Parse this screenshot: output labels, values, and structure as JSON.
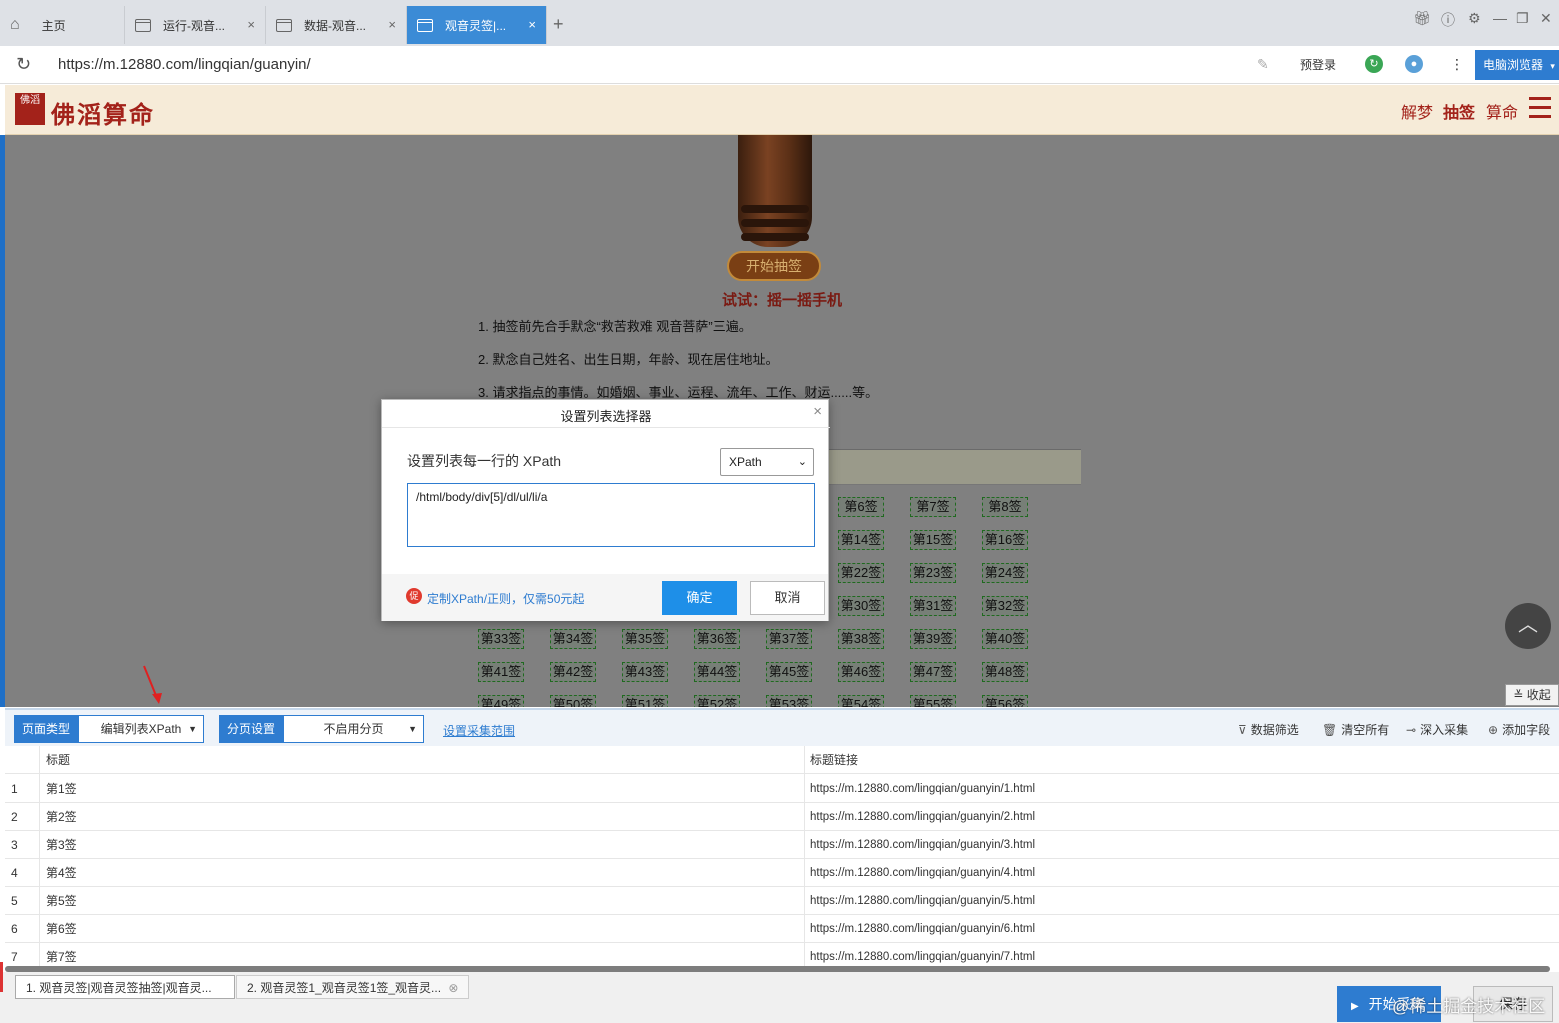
{
  "browser": {
    "tabs": [
      {
        "label": "主页"
      },
      {
        "label": "运行-观音..."
      },
      {
        "label": "数据-观音..."
      },
      {
        "label": "观音灵签|..."
      }
    ],
    "new_tab": "+",
    "url": "https://m.12880.com/lingqian/guanyin/",
    "prelogin": "预登录",
    "pc_browser": "电脑浏览器",
    "more": "⋮"
  },
  "site": {
    "seal": "佛滔",
    "logo": "佛滔算命",
    "nav": [
      "解梦",
      "抽签",
      "算命"
    ],
    "start_button": "开始抽签",
    "try_text": "试试：摇一摇手机",
    "instructions": [
      "1. 抽签前先合手默念“救苦救难 观音菩萨”三遍。",
      "2. 默念自己姓名、出生日期，年龄、现在居住地址。",
      "3. 请求指点的事情。如婚姻、事业、运程、流年、工作、财运......等。"
    ],
    "lots_rows": [
      [
        "第6签",
        "第7签",
        "第8签"
      ],
      [
        "第14签",
        "第15签",
        "第16签"
      ],
      [
        "第22签",
        "第23签",
        "第24签"
      ],
      [
        "第30签",
        "第31签",
        "第32签"
      ],
      [
        "第33签",
        "第34签",
        "第35签",
        "第36签",
        "第37签",
        "第38签",
        "第39签",
        "第40签"
      ],
      [
        "第41签",
        "第42签",
        "第43签",
        "第44签",
        "第45签",
        "第46签",
        "第47签",
        "第48签"
      ],
      [
        "第49签",
        "第50签",
        "第51签",
        "第52签",
        "第53签",
        "第54签",
        "第55签",
        "第56签"
      ]
    ],
    "collapse": "收起"
  },
  "dialog": {
    "title": "设置列表选择器",
    "label": "设置列表每一行的 XPath",
    "select_value": "XPath",
    "xpath_value": "/html/body/div[5]/dl/ul/li/a",
    "promo": "定制XPath/正则，仅需50元起",
    "promo_icon": "促",
    "ok": "确定",
    "cancel": "取消"
  },
  "toolbar": {
    "page_type_label": "页面类型",
    "page_type_value": "编辑列表XPath",
    "paging_label": "分页设置",
    "paging_value": "不启用分页",
    "range_link": "设置采集范围",
    "actions": [
      "数据筛选",
      "清空所有",
      "深入采集",
      "添加字段"
    ]
  },
  "table": {
    "columns": [
      "标题",
      "标题链接"
    ],
    "rows": [
      {
        "idx": "1",
        "title": "第1签",
        "link": "https://m.12880.com/lingqian/guanyin/1.html"
      },
      {
        "idx": "2",
        "title": "第2签",
        "link": "https://m.12880.com/lingqian/guanyin/2.html"
      },
      {
        "idx": "3",
        "title": "第3签",
        "link": "https://m.12880.com/lingqian/guanyin/3.html"
      },
      {
        "idx": "4",
        "title": "第4签",
        "link": "https://m.12880.com/lingqian/guanyin/4.html"
      },
      {
        "idx": "5",
        "title": "第5签",
        "link": "https://m.12880.com/lingqian/guanyin/5.html"
      },
      {
        "idx": "6",
        "title": "第6签",
        "link": "https://m.12880.com/lingqian/guanyin/6.html"
      },
      {
        "idx": "7",
        "title": "第7签",
        "link": "https://m.12880.com/lingqian/guanyin/7.html"
      }
    ]
  },
  "bottom": {
    "tabs": [
      "1. 观音灵签|观音灵签抽签|观音灵...",
      "2. 观音灵签1_观音灵签1签_观音灵..."
    ],
    "run": "开始采集",
    "save": "保存",
    "watermark": "@稀土掘金技术社区"
  },
  "colors": {
    "accent": "#2e7cd0",
    "brand_red": "#a3221a",
    "header_bg": "#f6ebd8",
    "overlay": "#808080"
  }
}
